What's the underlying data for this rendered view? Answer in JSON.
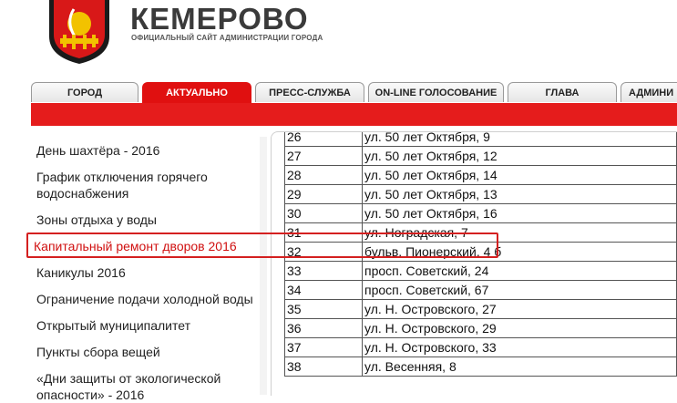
{
  "header": {
    "title": "КЕМЕРОВО",
    "subtitle": "ОФИЦИАЛЬНЫЙ САЙТ АДМИНИСТРАЦИИ ГОРОДА"
  },
  "tabs": [
    {
      "label": "ГОРОД"
    },
    {
      "label": "АКТУАЛЬНО"
    },
    {
      "label": "ПРЕСС-СЛУЖБА"
    },
    {
      "label": "ON-LINE ГОЛОСОВАНИЕ"
    },
    {
      "label": "ГЛАВА"
    },
    {
      "label": "АДМИНИ"
    }
  ],
  "sidebar": {
    "items": [
      {
        "label": "День шахтёра - 2016"
      },
      {
        "label": "График отключения горячего водоснабжения"
      },
      {
        "label": "Зоны отдыха у воды"
      },
      {
        "label": "Капитальный ремонт дворов 2016"
      },
      {
        "label": "Каникулы 2016"
      },
      {
        "label": "Ограничение подачи холодной воды"
      },
      {
        "label": "Открытый муниципалитет"
      },
      {
        "label": "Пункты сбора вещей"
      },
      {
        "label": "«Дни защиты от экологической опасности» - 2016"
      }
    ]
  },
  "table": {
    "rows": [
      [
        "26",
        "ул. 50 лет Октября, 9"
      ],
      [
        "27",
        "ул. 50 лет Октября, 12"
      ],
      [
        "28",
        "ул. 50 лет Октября, 14"
      ],
      [
        "29",
        "ул. 50 лет Октября, 13"
      ],
      [
        "30",
        "ул. 50 лет Октября, 16"
      ],
      [
        "31",
        "ул. Ноградская, 7"
      ],
      [
        "32",
        "бульв. Пионерский, 4 б"
      ],
      [
        "33",
        "просп. Советский, 24"
      ],
      [
        "34",
        "просп. Советский, 67"
      ],
      [
        "35",
        "ул. Н. Островского, 27"
      ],
      [
        "36",
        "ул. Н. Островского, 29"
      ],
      [
        "37",
        "ул. Н. Островского, 33"
      ],
      [
        "38",
        "ул. Весенняя, 8"
      ]
    ]
  }
}
